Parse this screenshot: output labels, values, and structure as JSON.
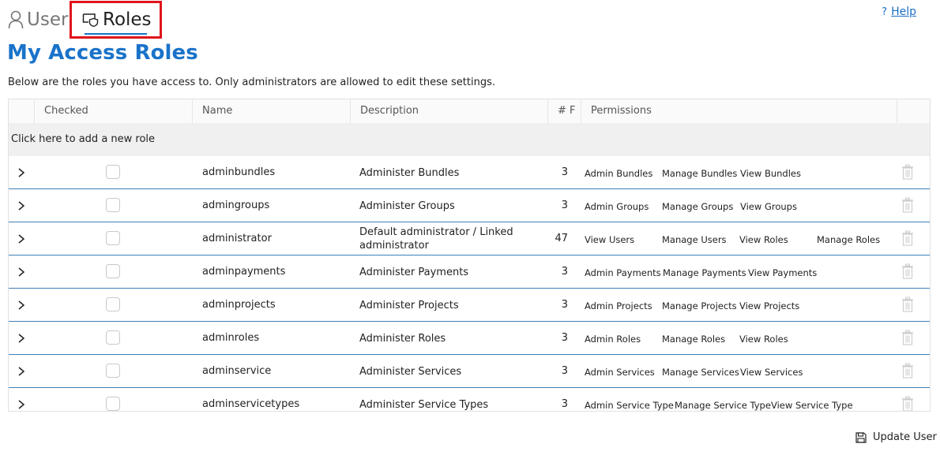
{
  "tabs": [
    {
      "label": "User",
      "icon": "user-icon"
    },
    {
      "label": "Roles",
      "icon": "roles-icon",
      "active": true
    }
  ],
  "help": {
    "icon": "?",
    "label": "Help"
  },
  "title": "My Access Roles",
  "description": "Below are the roles you have access to. Only administrators are allowed to edit these settings.",
  "columns": [
    "Checked",
    "Name",
    "Description",
    "# F",
    "Permissions"
  ],
  "add_row_label": "Click here to add a new role",
  "rows": [
    {
      "name": "adminbundles",
      "description": "Administer Bundles",
      "count": "3",
      "permissions": [
        "Admin Bundles",
        "Manage Bundles",
        "View Bundles"
      ]
    },
    {
      "name": "admingroups",
      "description": "Administer Groups",
      "count": "3",
      "permissions": [
        "Admin Groups",
        "Manage Groups",
        "View Groups"
      ]
    },
    {
      "name": "administrator",
      "description": "Default administrator / Linked administrator",
      "count": "47",
      "permissions": [
        "View Users",
        "Manage Users",
        "View Roles",
        "Manage Roles"
      ]
    },
    {
      "name": "adminpayments",
      "description": "Administer Payments",
      "count": "3",
      "permissions": [
        "Admin Payments",
        "Manage Payments",
        "View Payments"
      ]
    },
    {
      "name": "adminprojects",
      "description": "Administer Projects",
      "count": "3",
      "permissions": [
        "Admin Projects",
        "Manage Projects",
        "View Projects"
      ]
    },
    {
      "name": "adminroles",
      "description": "Administer Roles",
      "count": "3",
      "permissions": [
        "Admin Roles",
        "Manage Roles",
        "View Roles"
      ]
    },
    {
      "name": "adminservice",
      "description": "Administer Services",
      "count": "3",
      "permissions": [
        "Admin Services",
        "Manage Services",
        "View Services"
      ]
    },
    {
      "name": "adminservicetypes",
      "description": "Administer Service Types",
      "count": "3",
      "permissions": [
        "Admin Service Type",
        "Manage Service Type",
        "View Service Type"
      ]
    }
  ],
  "update_button": {
    "label": "Update User",
    "icon": "save-icon"
  },
  "colors": {
    "accent": "#1a73c9",
    "highlight_box": "#e0151b",
    "row_divider": "#3f7fb5"
  }
}
